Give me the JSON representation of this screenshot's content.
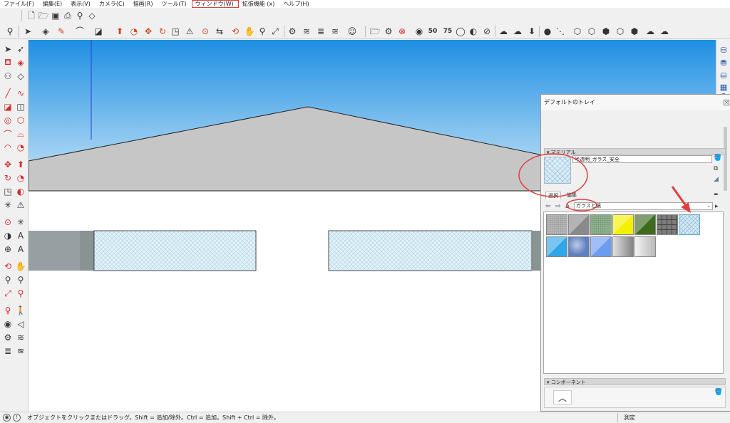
{
  "menu": [
    "ファイル(F)",
    "編集(E)",
    "表示(V)",
    "カメラ(C)",
    "描画(R)",
    "ツール(T)",
    "ウィンドウ(W)",
    "拡張機能 (x)",
    "ヘルプ(H)"
  ],
  "highlighted_menu": "ウィンドウ(W)",
  "toolbar_badges": {
    "fifty": "50",
    "seventyfive": "75"
  },
  "tray": {
    "title": "デフォルトのトレイ",
    "materials_section": "マテリアル",
    "material_name": "半透明_ガラス_安全",
    "tabs": [
      "選択",
      "編集"
    ],
    "library": "ガラスと鏡",
    "components_section": "コンポーネント"
  },
  "swatches": [
    {
      "name": "concrete",
      "color": "#b8b8b8"
    },
    {
      "name": "steel-diagonal",
      "color": "#8a8a8a"
    },
    {
      "name": "green-glass",
      "color": "#8fb48f"
    },
    {
      "name": "yellow-glass",
      "color": "#f4f000"
    },
    {
      "name": "dark-green-glass",
      "color": "#3e6a1e"
    },
    {
      "name": "metal-grid",
      "color": "#7c7c7c"
    },
    {
      "name": "translucent-glass-safety",
      "color": "#d6ecf6"
    },
    {
      "name": "cyan-glass",
      "color": "#2ea6e8"
    },
    {
      "name": "sky-reflection",
      "color": "#5f7fc0"
    },
    {
      "name": "blue-glass",
      "color": "#6c9cf0"
    },
    {
      "name": "silver-mirror",
      "color": "#9a9a9a"
    },
    {
      "name": "white-mirror",
      "color": "#d8d8d8"
    }
  ],
  "status": {
    "hint": "オブジェクトをクリックまたはドラッグ。Shift = 追加/除外。Ctrl = 追加。Shift + Ctrl = 除外。",
    "measure_label": "測定"
  },
  "colors": {
    "sky_top": "#1e8fe3",
    "sky_bottom": "#cbe6f7",
    "roof": "#c6c6c6",
    "annotation_red": "#e04040"
  }
}
